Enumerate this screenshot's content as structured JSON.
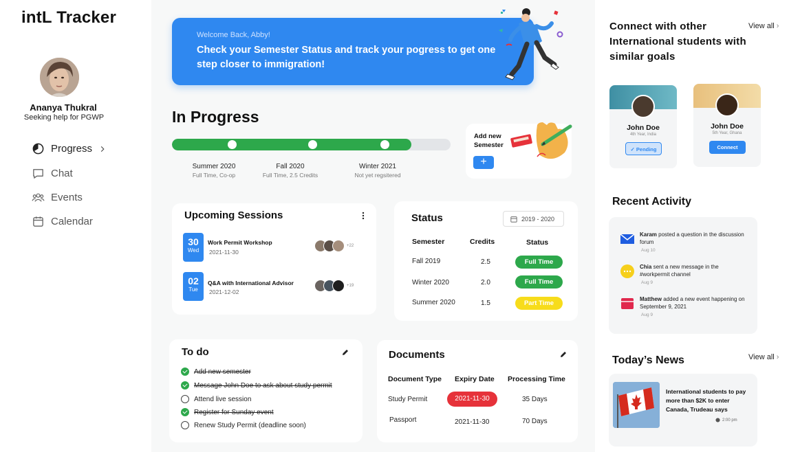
{
  "app": {
    "logo": "intL Tracker"
  },
  "user": {
    "name": "Ananya Thukral",
    "subtitle": "Seeking help for PGWP"
  },
  "nav": {
    "progress": "Progress",
    "chat": "Chat",
    "events": "Events",
    "calendar": "Calendar"
  },
  "welcome": {
    "greeting": "Welcome Back, Abby!",
    "message": "Check your Semester Status and track your pogress to get one step closer to immigration!"
  },
  "progress": {
    "title": "In Progress",
    "percent": 86,
    "stages": [
      {
        "name": "Summer 2020",
        "detail": "Full Time, Co-op"
      },
      {
        "name": "Fall 2020",
        "detail": "Full Time, 2.5 Credits"
      },
      {
        "name": "Winter 2021",
        "detail": "Not yet regsitered"
      }
    ],
    "add_label": "Add new Semester",
    "add_button": "+"
  },
  "sessions": {
    "title": "Upcoming Sessions",
    "items": [
      {
        "day": "30",
        "weekday": "Wed",
        "name": "Work Permit Workshop",
        "date": "2021-11-30",
        "more": "+22"
      },
      {
        "day": "02",
        "weekday": "Tue",
        "name": "Q&A with International Advisor",
        "date": "2021-12-02",
        "more": "+19"
      }
    ]
  },
  "status": {
    "title": "Status",
    "range": "2019 - 2020",
    "headers": [
      "Semester",
      "Credits",
      "Status"
    ],
    "rows": [
      {
        "semester": "Fall 2019",
        "credits": "2.5",
        "status": "Full Time",
        "color": "#2da84b"
      },
      {
        "semester": "Winter 2020",
        "credits": "2.0",
        "status": "Full Time",
        "color": "#2da84b"
      },
      {
        "semester": "Summer 2020",
        "credits": "1.5",
        "status": "Part Time",
        "color": "#f7dc1b"
      }
    ]
  },
  "todo": {
    "title": "To do",
    "items": [
      {
        "text": "Add new semester",
        "done": true
      },
      {
        "text": "Message John Doe to ask about study permit",
        "done": true
      },
      {
        "text": "Attend live session",
        "done": false
      },
      {
        "text": "Register for Sunday event",
        "done": true
      },
      {
        "text": "Renew Study Permit (deadline soon)",
        "done": false
      }
    ]
  },
  "documents": {
    "title": "Documents",
    "headers": [
      "Document Type",
      "Expiry Date",
      "Processing Time"
    ],
    "rows": [
      {
        "type": "Study Permit",
        "expiry": "2021-11-30",
        "processing": "35 Days",
        "urgent": true
      },
      {
        "type": "Passport",
        "expiry": "2021-11-30",
        "processing": "70 Days",
        "urgent": false
      }
    ]
  },
  "connect": {
    "title": "Connect with other International students with similar goals",
    "view_all": "View all",
    "people": [
      {
        "name": "John Doe",
        "meta": "4th Year, India",
        "button": "Pending"
      },
      {
        "name": "John Doe",
        "meta": "5th Year, Ghana",
        "button": "Connect"
      }
    ]
  },
  "activity": {
    "title": "Recent Activity",
    "items": [
      {
        "who": "Karam",
        "text": "posted a question in the discussion forum",
        "time": "Aug 10",
        "icon": "mail-icon"
      },
      {
        "who": "Chia",
        "text": "sent a new message in the #workpermit channel",
        "time": "Aug 9",
        "icon": "chat-bubble-icon"
      },
      {
        "who": "Matthew",
        "text": "added a new event happening on September 9, 2021",
        "time": "Aug 9",
        "icon": "calendar-icon"
      }
    ]
  },
  "news": {
    "title": "Today’s News",
    "view_all": "View all",
    "headline": "International students to pay more than $2K to enter Canada, Trudeau says",
    "time": "2:00 pm"
  },
  "colors": {
    "primary": "#2f88f0",
    "green": "#2da84b",
    "yellow": "#f7dc1b",
    "red": "#e6323a"
  }
}
